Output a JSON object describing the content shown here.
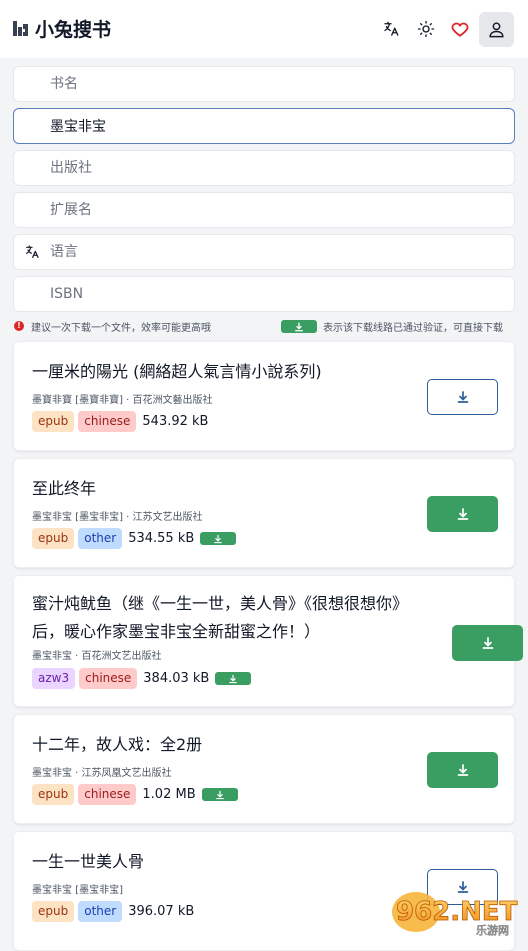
{
  "header": {
    "app_title": "小兔搜书",
    "icons": [
      "chart-logo-icon",
      "translate-icon",
      "theme-sun-icon",
      "heart-icon",
      "user-icon"
    ],
    "heart_color": "#dc2626"
  },
  "search": {
    "book_name_placeholder": "书名",
    "author_value": "墨宝非宝",
    "publisher_placeholder": "出版社",
    "extension_placeholder": "扩展名",
    "language_placeholder": "语言",
    "isbn_placeholder": "ISBN"
  },
  "notices": {
    "tip": "建议一次下载一个文件，效率可能更高哦",
    "verified_legend": "表示该下载线路已通过验证，可直接下载"
  },
  "results": [
    {
      "title": "一厘米的陽光 (網絡超人氣言情小說系列)",
      "meta": "墨寶非寶 [墨寶非寶] · 百花洲文藝出版社",
      "format": "epub",
      "language": "chinese",
      "size": "543.92 kB",
      "verified": false
    },
    {
      "title": "至此终年",
      "meta": "墨宝非宝 [墨宝非宝] · 江苏文艺出版社",
      "format": "epub",
      "language": "other",
      "size": "534.55 kB",
      "verified": true
    },
    {
      "title": "蜜汁炖鱿鱼（继《一生一世，美人骨》《很想很想你》后，暖心作家墨宝非宝全新甜蜜之作！）",
      "meta": "墨宝非宝 · 百花洲文艺出版社",
      "format": "azw3",
      "language": "chinese",
      "size": "384.03 kB",
      "verified": true
    },
    {
      "title": "十二年，故人戏：全2册",
      "meta": "墨宝非宝 · 江苏凤凰文艺出版社",
      "format": "epub",
      "language": "chinese",
      "size": "1.02 MB",
      "verified": true
    },
    {
      "title": "一生一世美人骨",
      "meta": "墨宝非宝 [墨宝非宝]",
      "format": "epub",
      "language": "other",
      "size": "396.07 kB",
      "verified": false
    }
  ],
  "watermark": {
    "text_main": "962.NET",
    "text_sub": "乐游网"
  }
}
